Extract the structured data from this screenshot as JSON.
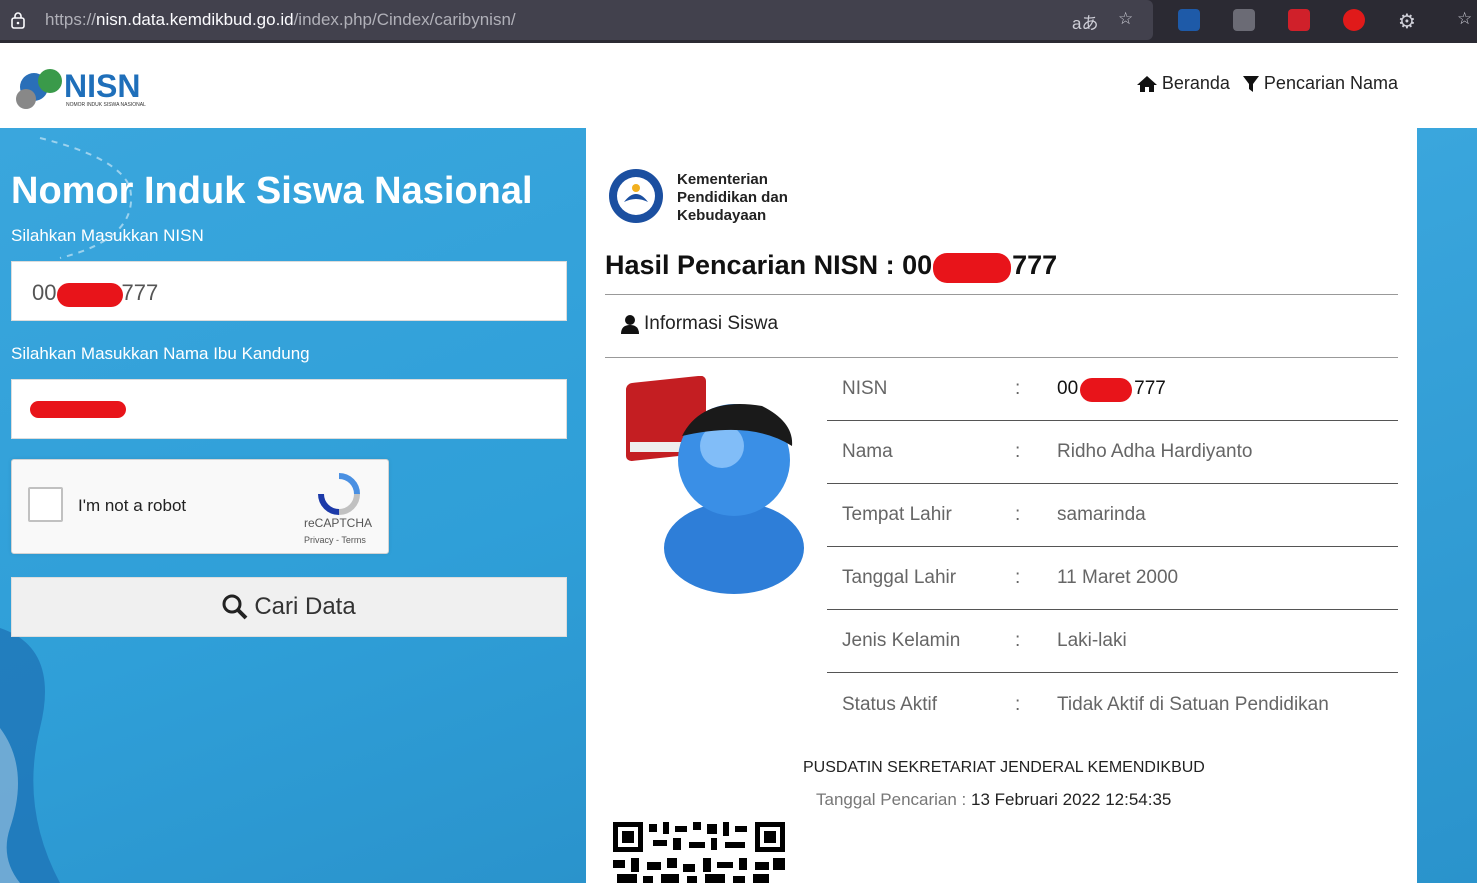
{
  "browser": {
    "url_prefix": "https://",
    "url_host": "nisn.data.kemdikbud.go.id",
    "url_path": "/index.php/Cindex/caribynisn/",
    "translate_icon": "aあ"
  },
  "header": {
    "nav": [
      {
        "label": "Beranda",
        "icon": "home-icon"
      },
      {
        "label": "Pencarian Nama",
        "icon": "filter-icon"
      }
    ]
  },
  "search": {
    "title": "Nomor Induk Siswa Nasional",
    "nisn_label": "Silahkan Masukkan NISN",
    "nisn_prefix": "00",
    "nisn_suffix": "777",
    "mother_label": "Silahkan Masukkan Nama Ibu Kandung",
    "captcha_label": "I'm not a robot",
    "captcha_brand": "reCAPTCHA",
    "captcha_links": "Privacy - Terms",
    "button_label": "Cari Data"
  },
  "result": {
    "ministry_line1": "Kementerian",
    "ministry_line2": "Pendidikan dan",
    "ministry_line3": "Kebudayaan",
    "title_prefix": "Hasil Pencarian NISN : 00",
    "title_suffix": "777",
    "section_title": "Informasi Siswa",
    "rows": [
      {
        "key": "NISN",
        "value": "00",
        "value_suffix": "777"
      },
      {
        "key": "Nama",
        "value": "Ridho Adha Hardiyanto"
      },
      {
        "key": "Tempat Lahir",
        "value": "samarinda"
      },
      {
        "key": "Tanggal Lahir",
        "value": "11 Maret 2000"
      },
      {
        "key": "Jenis Kelamin",
        "value": "Laki-laki"
      },
      {
        "key": "Status Aktif",
        "value": "Tidak Aktif di Satuan Pendidikan"
      }
    ],
    "colon": ":",
    "footer_org": "PUSDATIN SEKRETARIAT JENDERAL KEMENDIKBUD",
    "footer_date_label": "Tanggal Pencarian : ",
    "footer_date": "13 Februari 2022 12:54:35"
  }
}
